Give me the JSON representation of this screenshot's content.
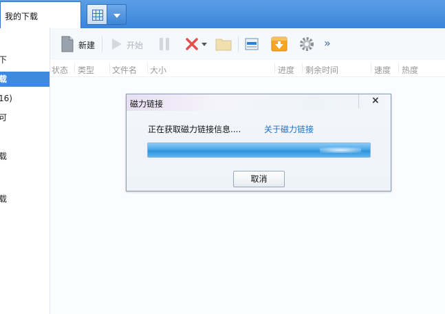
{
  "topbar": {
    "active_tab_label": "我的下载",
    "grid_icon": "grid-icon",
    "dropdown_icon": "chevron-down-icon"
  },
  "sidebar": {
    "items": [
      {
        "label": "下"
      },
      {
        "label": "载"
      },
      {
        "label": "16)"
      },
      {
        "label": "可"
      },
      {
        "label": "载"
      },
      {
        "label": "载"
      }
    ]
  },
  "toolbar": {
    "new_label": "新建",
    "start_label": "开始",
    "more_label": "»"
  },
  "columns": [
    "状态",
    "类型",
    "文件名",
    "大小",
    "进度",
    "剩余时间",
    "速度",
    "热度"
  ],
  "dialog": {
    "title": "磁力链接",
    "close_label": "×",
    "message": "正在获取磁力链接信息....",
    "link_text": "关于磁力链接",
    "progress": 1.0,
    "cancel_label": "取消"
  },
  "colors": {
    "accent": "#3d8be0",
    "link": "#1f6fc8",
    "progress": "#3a9be4"
  }
}
